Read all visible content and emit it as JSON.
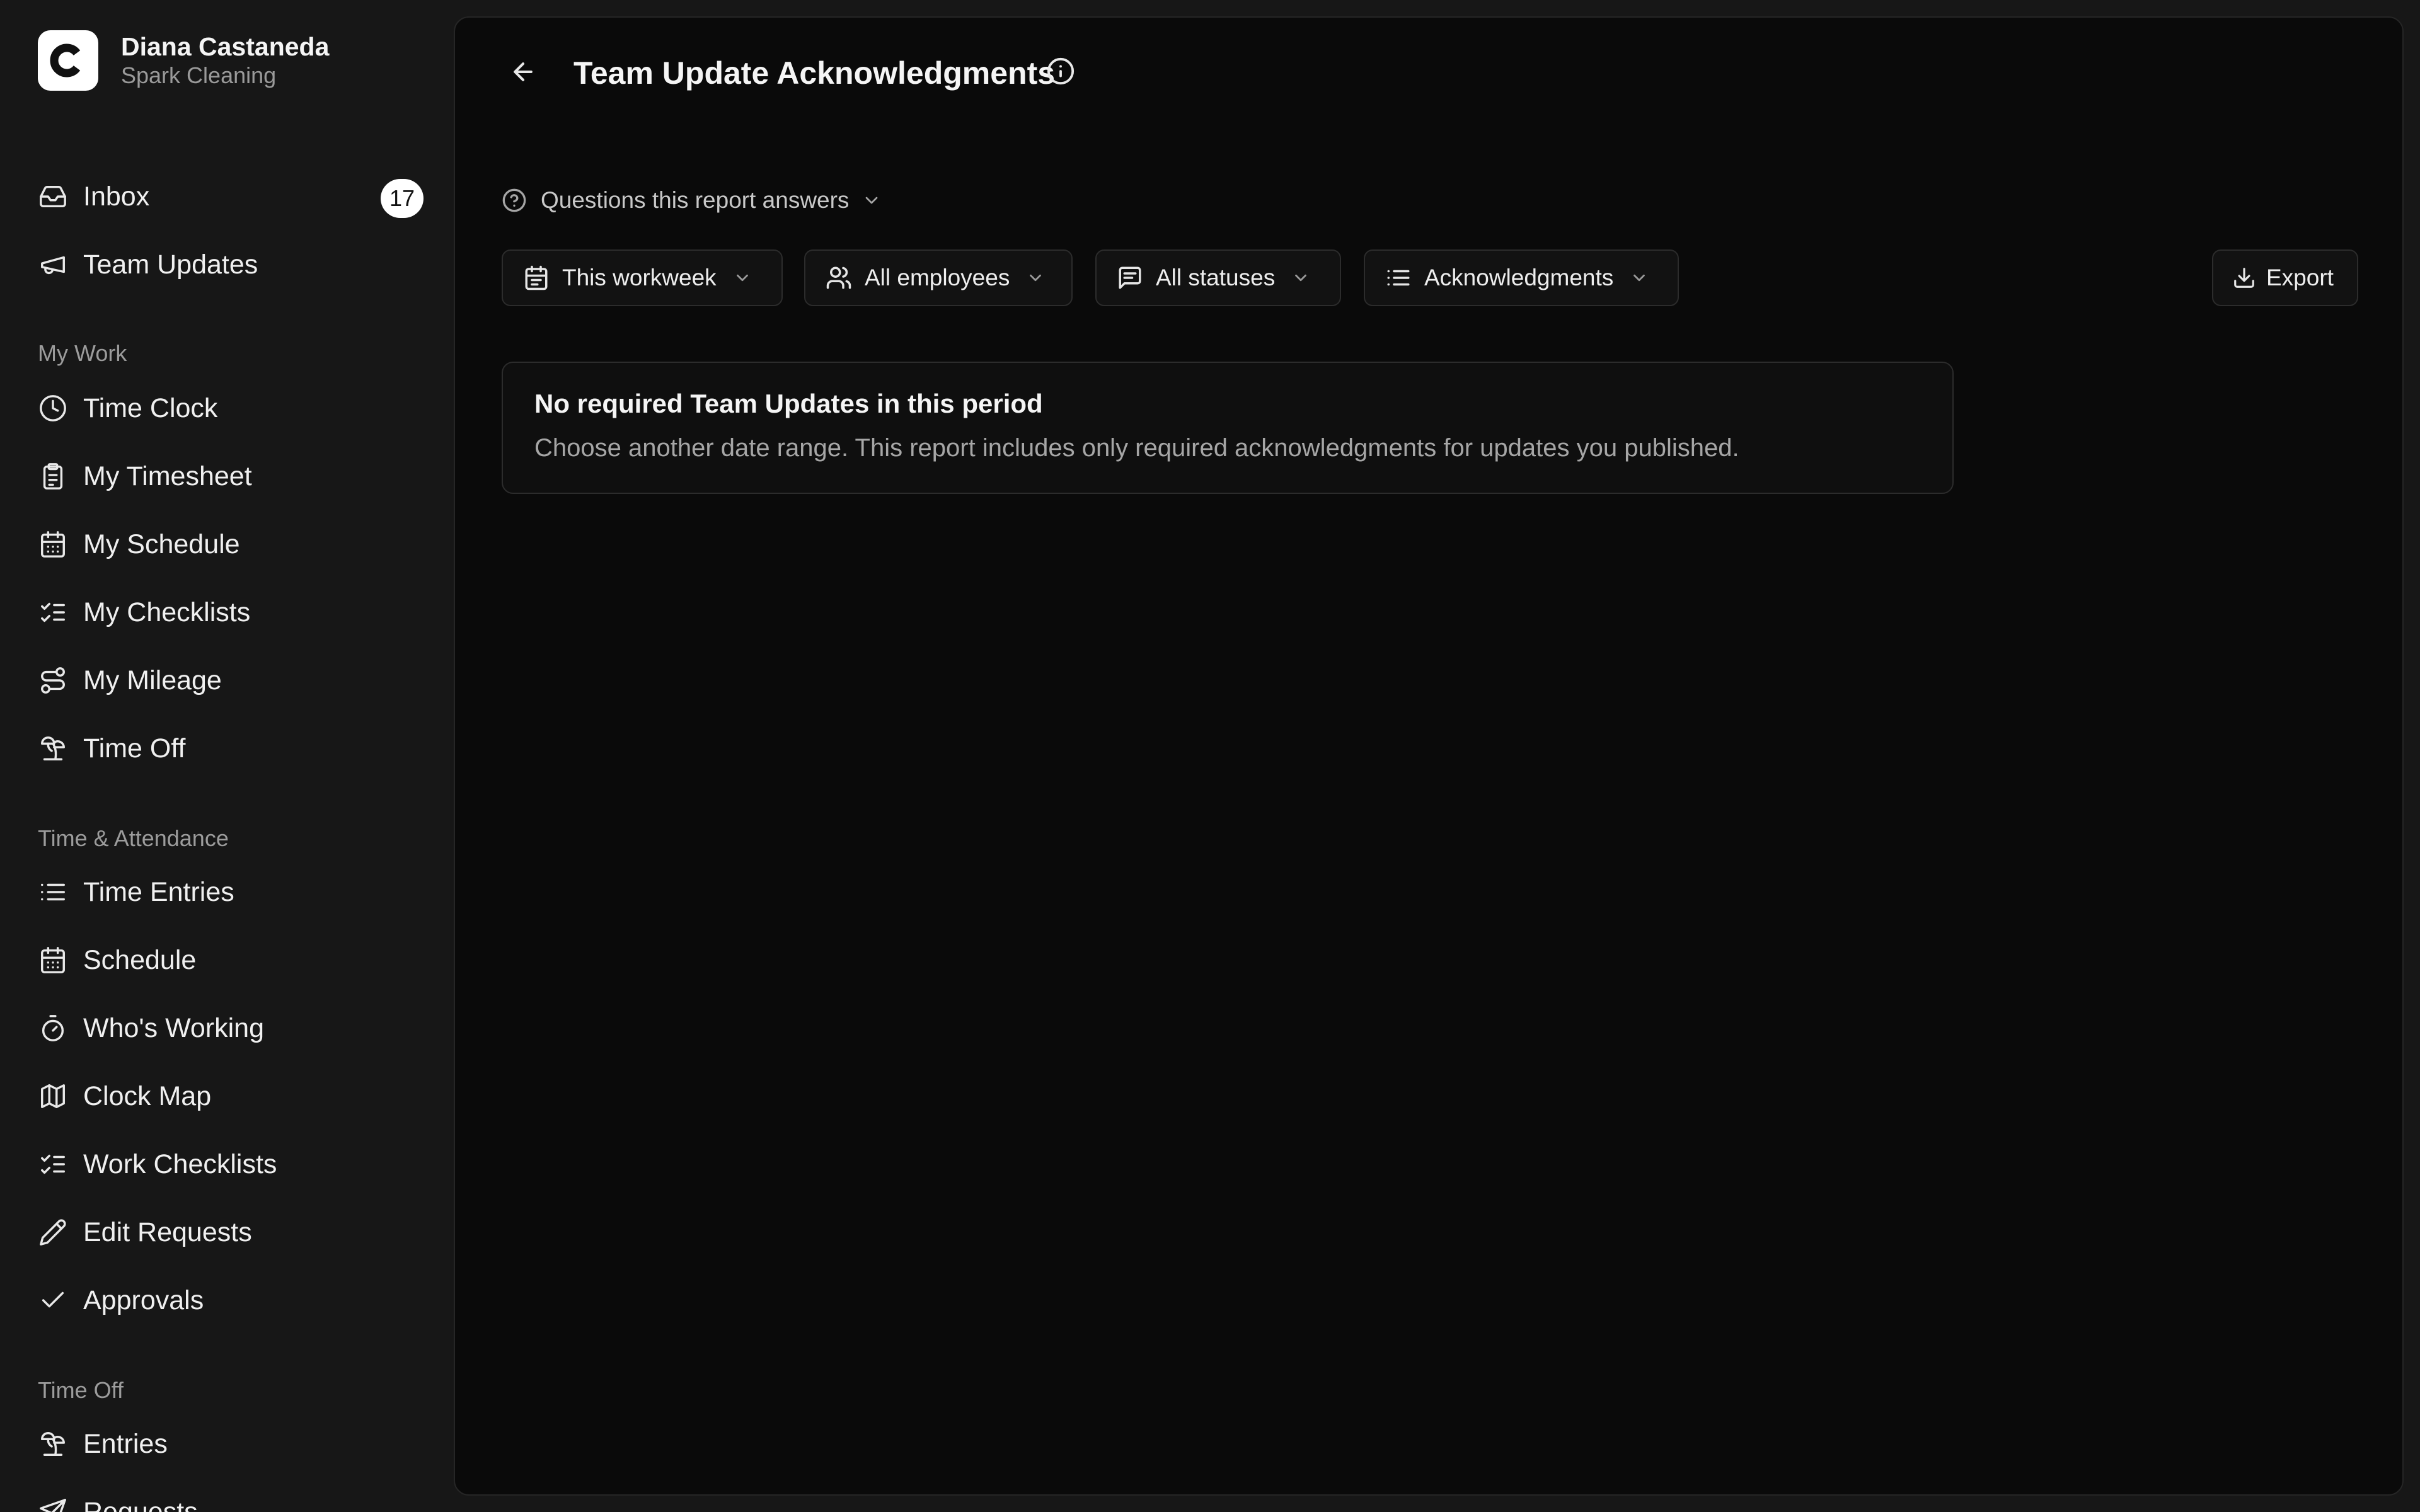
{
  "profile": {
    "name": "Diana Castaneda",
    "org": "Spark Cleaning"
  },
  "nav": {
    "inbox": {
      "label": "Inbox",
      "count": "17"
    },
    "team_updates": "Team Updates",
    "sections": {
      "my_work": "My Work",
      "time_attendance": "Time & Attendance",
      "time_off": "Time Off"
    },
    "my_work_items": [
      "Time Clock",
      "My Timesheet",
      "My Schedule",
      "My Checklists",
      "My Mileage",
      "Time Off"
    ],
    "time_attendance_items": [
      "Time Entries",
      "Schedule",
      "Who's Working",
      "Clock Map",
      "Work Checklists",
      "Edit Requests",
      "Approvals"
    ],
    "time_off_items": [
      "Entries",
      "Requests"
    ]
  },
  "header": {
    "title": "Team Update Acknowledgments"
  },
  "questions_toggle": "Questions this report answers",
  "filters": {
    "period": "This workweek",
    "employees": "All employees",
    "statuses": "All statuses",
    "view": "Acknowledgments",
    "export": "Export"
  },
  "empty_state": {
    "title": "No required Team Updates in this period",
    "description": "Choose another date range. This report includes only required acknowledgments for updates you published."
  }
}
